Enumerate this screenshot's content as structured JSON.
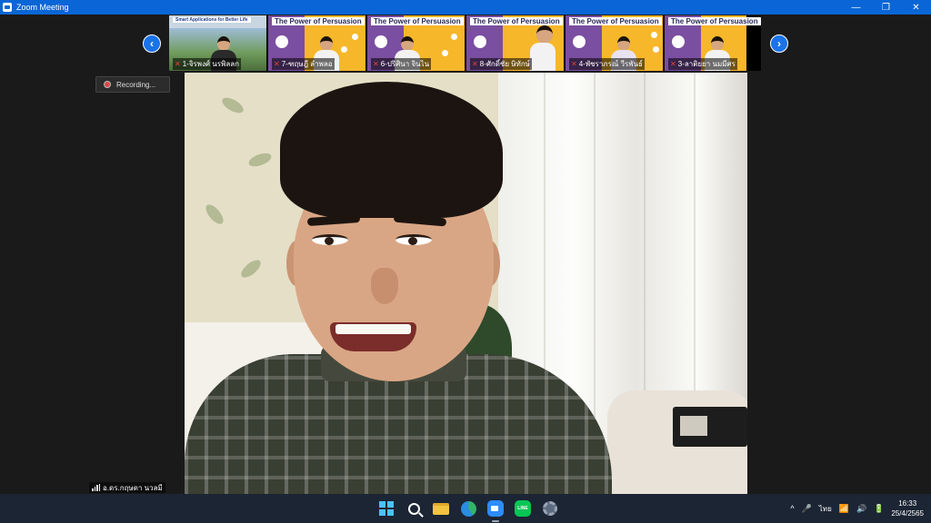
{
  "window": {
    "title": "Zoom Meeting",
    "minimize": "—",
    "restore": "❐",
    "close": "✕"
  },
  "gallery": {
    "prev": "‹",
    "next": "›",
    "tiles": [
      {
        "name": "1-จิรพงศ์ นรพิลลก",
        "heading": "Smart Applications for Better Life",
        "kind": "slide-scenic"
      },
      {
        "name": "7-ฑฤษฎี ลำพลอ",
        "heading": "The Power of Persuasion",
        "kind": "slide"
      },
      {
        "name": "6-ปริศินา จินไน",
        "heading": "The Power of Persuasion",
        "kind": "slide"
      },
      {
        "name": "8-ศักดิ์ชัย ษิทักษ์",
        "heading": "The Power of Persuasion",
        "kind": "slide"
      },
      {
        "name": "4-พัชราภรณ์ วีรพันธ์",
        "heading": "The Power of Persuasion",
        "kind": "slide"
      },
      {
        "name": "3-ลาติยยา นมมีศร",
        "heading": "The Power of Persuasion",
        "kind": "slide"
      }
    ]
  },
  "recording": {
    "label": "Recording..."
  },
  "speaker": {
    "name": "อ.ดร.กฤษดา นวลมี"
  },
  "taskbar": {
    "apps": [
      "start-icon",
      "search-icon",
      "file-explorer-icon",
      "edge-icon",
      "zoom-icon",
      "line-icon",
      "settings-icon"
    ],
    "line_label": "LINE",
    "tray": {
      "chevron": "^",
      "mic": "🎤",
      "language": "ไทย",
      "wifi": "📶",
      "volume": "🔊",
      "battery": "🔋",
      "time": "16:33",
      "date": "25/4/2565"
    }
  },
  "colors": {
    "titlebar": "#0a66d6",
    "taskbar": "#1c2534",
    "nav_button": "#1a73e8",
    "slide_bg": "#f6b72a"
  }
}
